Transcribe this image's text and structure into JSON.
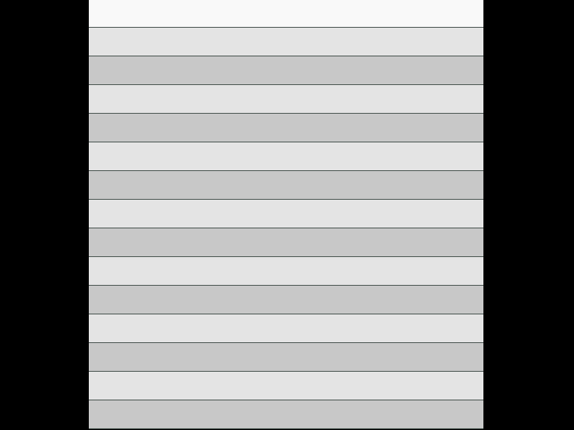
{
  "colors": {
    "background": "#000000",
    "header": "#f9f9f9",
    "row_light": "#e4e4e4",
    "row_dark": "#c8c8c8",
    "divider": "#5a6460"
  },
  "list": {
    "row_count": 14,
    "rows": [
      {
        "shade": "light"
      },
      {
        "shade": "dark"
      },
      {
        "shade": "light"
      },
      {
        "shade": "dark"
      },
      {
        "shade": "light"
      },
      {
        "shade": "dark"
      },
      {
        "shade": "light"
      },
      {
        "shade": "dark"
      },
      {
        "shade": "light"
      },
      {
        "shade": "dark"
      },
      {
        "shade": "light"
      },
      {
        "shade": "dark"
      },
      {
        "shade": "light"
      },
      {
        "shade": "dark"
      }
    ]
  }
}
